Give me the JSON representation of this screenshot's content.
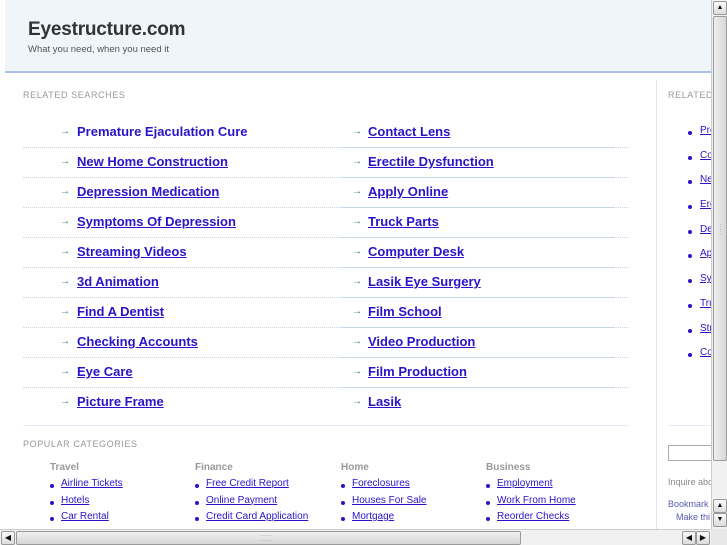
{
  "header": {
    "title": "Eyestructure.com",
    "tagline": "What you need, when you need it"
  },
  "related": {
    "label": "RELATED SEARCHES",
    "arrow_icon": "→",
    "left": [
      "Premature Ejaculation Cure",
      "New Home Construction",
      "Depression Medication",
      "Symptoms Of Depression",
      "Streaming Videos",
      "3d Animation",
      "Find A Dentist",
      "Checking Accounts",
      "Eye Care",
      "Picture Frame"
    ],
    "right": [
      "Contact Lens",
      "Erectile Dysfunction",
      "Apply Online",
      "Truck Parts",
      "Computer Desk",
      "Lasik Eye Surgery",
      "Film School",
      "Video Production",
      "Film Production",
      "Lasik"
    ]
  },
  "popular": {
    "label": "POPULAR CATEGORIES",
    "categories": [
      {
        "name": "Travel",
        "items": [
          "Airline Tickets",
          "Hotels",
          "Car Rental"
        ]
      },
      {
        "name": "Finance",
        "items": [
          "Free Credit Report",
          "Online Payment",
          "Credit Card Application"
        ]
      },
      {
        "name": "Home",
        "items": [
          "Foreclosures",
          "Houses For Sale",
          "Mortgage"
        ]
      },
      {
        "name": "Business",
        "items": [
          "Employment",
          "Work From Home",
          "Reorder Checks"
        ]
      }
    ]
  },
  "sidebar": {
    "label": "RELATED",
    "items": [
      "Pre",
      "Co",
      "Ne",
      "Ere",
      "De",
      "Ap",
      "Sy",
      "Tru",
      "Str",
      "Co"
    ],
    "inquire": "Inquire abo",
    "bookmark": "Bookmark",
    "make": "Make thi"
  },
  "scrollbars": {
    "up_icon": "▲",
    "down_icon": "▼",
    "left_icon": "◀",
    "right_icon": "▶"
  },
  "colors": {
    "link": "#2a13c9",
    "arrow": "#2e7d6e",
    "header_bg": "#eff5f8",
    "header_border": "#a9c0e8"
  }
}
